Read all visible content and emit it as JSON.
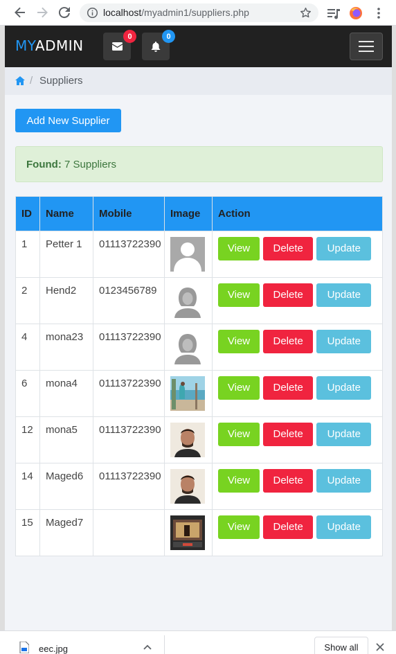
{
  "browser": {
    "url_host": "localhost",
    "url_path": "/myadmin1/suppliers.php"
  },
  "navbar": {
    "brand_prefix": "MY",
    "brand_suffix": "ADMIN",
    "messages_count": "0",
    "notifications_count": "0"
  },
  "breadcrumb": {
    "separator": "/",
    "current": "Suppliers"
  },
  "actions": {
    "add_label": "Add New Supplier"
  },
  "alert": {
    "label": "Found:",
    "text": "7 Suppliers"
  },
  "table": {
    "headers": [
      "ID",
      "Name",
      "Mobile",
      "Image",
      "Action"
    ],
    "buttons": {
      "view": "View",
      "delete": "Delete",
      "update": "Update"
    },
    "rows": [
      {
        "id": "1",
        "name": "Petter 1",
        "mobile": "01113722390",
        "image": "male-avatar-icon"
      },
      {
        "id": "2",
        "name": "Hend2",
        "mobile": "0123456789",
        "image": "female-avatar-icon"
      },
      {
        "id": "4",
        "name": "mona23",
        "mobile": "01113722390",
        "image": "female-avatar-icon"
      },
      {
        "id": "6",
        "name": "mona4",
        "mobile": "01113722390",
        "image": "beach-photo"
      },
      {
        "id": "12",
        "name": "mona5",
        "mobile": "01113722390",
        "image": "portrait-photo"
      },
      {
        "id": "14",
        "name": "Maged6",
        "mobile": "01113722390",
        "image": "portrait-photo"
      },
      {
        "id": "15",
        "name": "Maged7",
        "mobile": "",
        "image": "game-screenshot-photo"
      }
    ]
  },
  "downloads": {
    "file_name": "eec.jpg",
    "show_all": "Show all"
  },
  "colors": {
    "primary": "#2196f3",
    "success": "#78d321",
    "danger": "#f0243f",
    "info": "#5bc0de",
    "navbar": "#212121"
  }
}
